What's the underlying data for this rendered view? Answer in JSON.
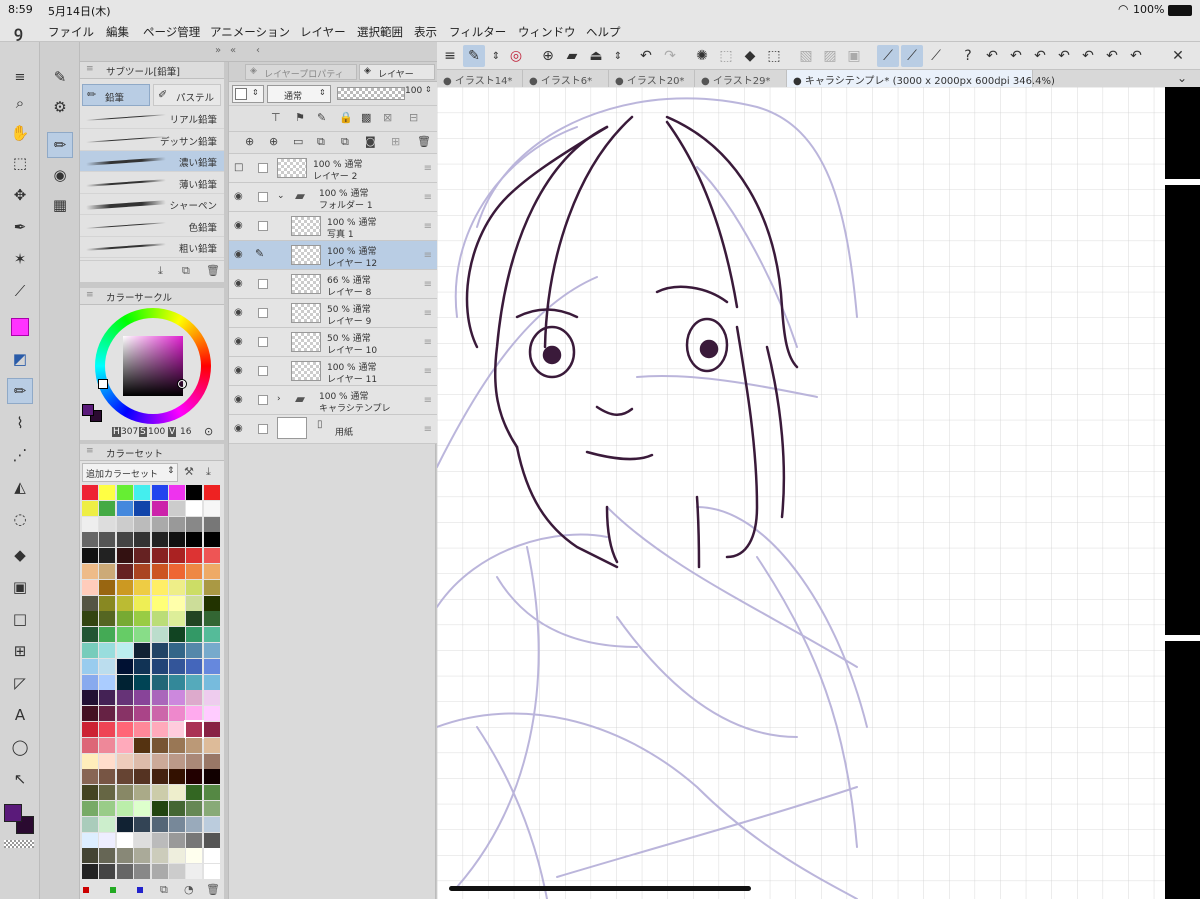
{
  "status": {
    "time": "8:59",
    "date": "5月14日(木)",
    "battery": "100%"
  },
  "menu": [
    "ファイル",
    "編集",
    "ページ管理",
    "アニメーション",
    "レイヤー",
    "選択範囲",
    "表示",
    "フィルター",
    "ウィンドウ",
    "ヘルプ"
  ],
  "doc_tabs": [
    "イラスト14*",
    "イラスト6*",
    "イラスト20*",
    "イラスト29*",
    "キャラシテンプレ* (3000 x 2000px 600dpi 346.4%)"
  ],
  "sub_tool": {
    "title": "サブツール[鉛筆]",
    "tabs": [
      "鉛筆",
      "パステル"
    ],
    "brushes": [
      "リアル鉛筆",
      "デッサン鉛筆",
      "濃い鉛筆",
      "薄い鉛筆",
      "シャーペン",
      "色鉛筆",
      "粗い鉛筆"
    ],
    "selected_brush": 2
  },
  "color_circle": {
    "title": "カラーサークル",
    "h_label": "H",
    "h": "307",
    "s_label": "S",
    "s": "100",
    "v_label": "V",
    "v": "16"
  },
  "color_set": {
    "title": "カラーセット",
    "set_name": "追加カラーセット"
  },
  "layer_panel": {
    "tab_property": "レイヤープロパティ",
    "tab_layer": "レイヤー",
    "blend_mode": "通常",
    "opacity": "100",
    "layers": [
      {
        "line1": "100 % 通常",
        "line2": "レイヤー 2"
      },
      {
        "line1": "100 % 通常",
        "line2": "フォルダー 1"
      },
      {
        "line1": "100 % 通常",
        "line2": "写真 1"
      },
      {
        "line1": "100 % 通常",
        "line2": "レイヤー 12"
      },
      {
        "line1": "66 % 通常",
        "line2": "レイヤー 8"
      },
      {
        "line1": "50 % 通常",
        "line2": "レイヤー 9"
      },
      {
        "line1": "50 % 通常",
        "line2": "レイヤー 10"
      },
      {
        "line1": "100 % 通常",
        "line2": "レイヤー 11"
      },
      {
        "line1": "100 % 通常",
        "line2": "キャラシテンプレ"
      },
      {
        "line1": "",
        "line2": "用紙"
      }
    ]
  },
  "colors": {
    "main": "#5a1a7a",
    "sub": "#2a0a30",
    "accent": "#b9cde4",
    "highlight": "#ff33ff"
  }
}
